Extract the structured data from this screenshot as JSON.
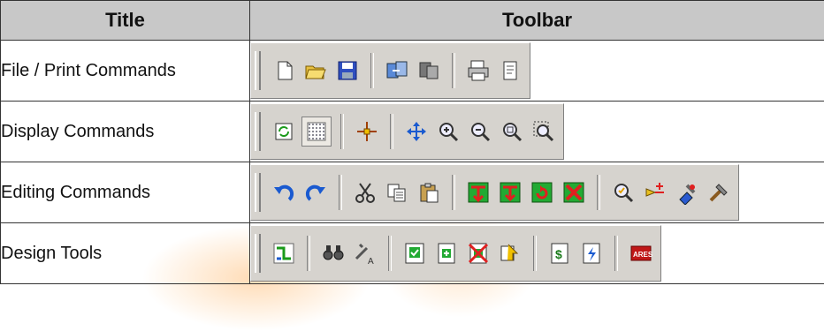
{
  "header": {
    "title_col": "Title",
    "toolbar_col": "Toolbar"
  },
  "rows": [
    {
      "title": "File / Print Commands",
      "icons": [
        "new-file-icon",
        "open-folder-icon",
        "save-icon",
        "|",
        "import-icon",
        "export-icon",
        "|",
        "print-icon",
        "print-preview-icon"
      ]
    },
    {
      "title": "Display Commands",
      "icons": [
        "redraw-icon",
        "grid-icon",
        "|",
        "origin-icon",
        "|",
        "pan-icon",
        "zoom-in-icon",
        "zoom-out-icon",
        "zoom-all-icon",
        "zoom-area-icon"
      ]
    },
    {
      "title": "Editing Commands",
      "icons": [
        "undo-icon",
        "redo-icon",
        "|",
        "cut-icon",
        "copy-icon",
        "paste-icon",
        "|",
        "block-copy-icon",
        "block-move-icon",
        "block-rotate-icon",
        "block-delete-icon",
        "|",
        "pick-device-icon",
        "make-device-icon",
        "package-tool-icon",
        "decompose-icon"
      ]
    },
    {
      "title": "Design Tools",
      "icons": [
        "wire-autoroute-icon",
        "|",
        "search-tag-icon",
        "property-tool-icon",
        "|",
        "electrical-rule-check-icon",
        "new-sheet-icon",
        "remove-sheet-icon",
        "goto-sheet-icon",
        "|",
        "bill-of-materials-icon",
        "netlist-icon",
        "|",
        "ares-icon"
      ]
    }
  ]
}
